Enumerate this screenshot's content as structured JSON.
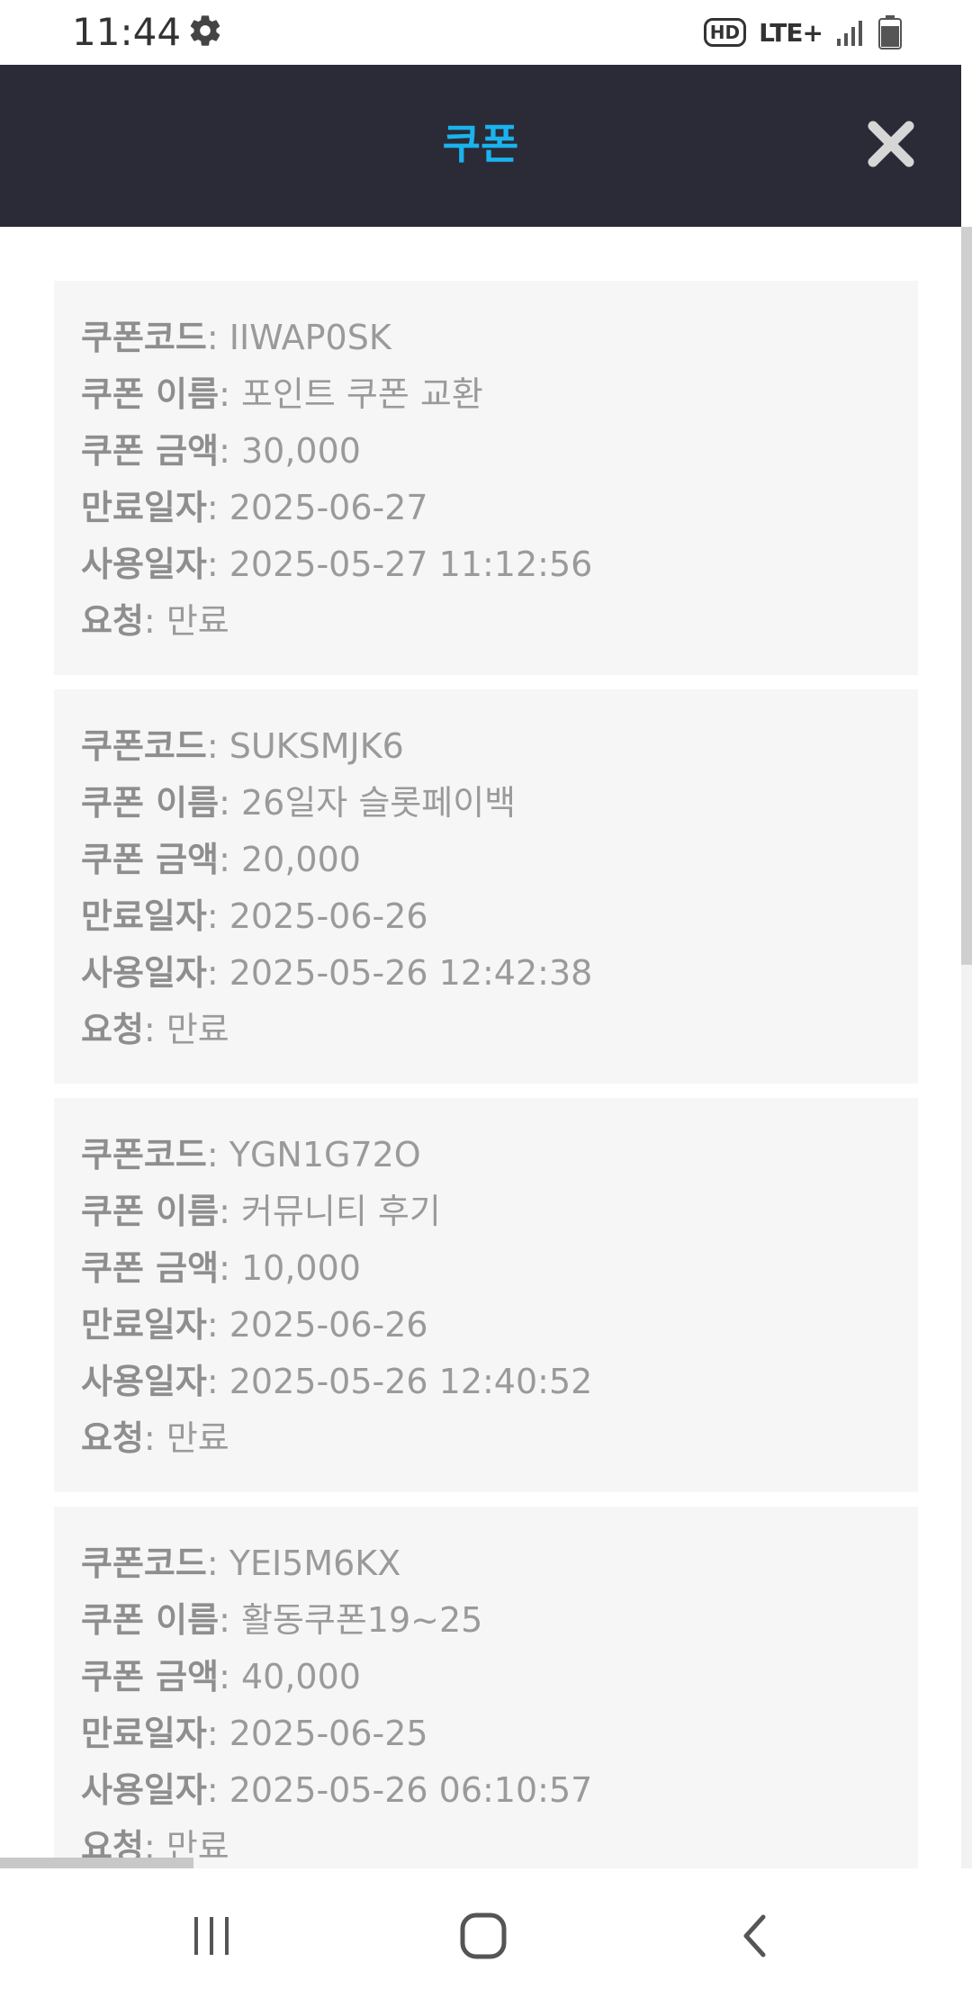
{
  "status_bar": {
    "time": "11:44",
    "hd_badge": "HD",
    "network": "LTE+"
  },
  "header": {
    "title": "쿠폰"
  },
  "labels": {
    "code": "쿠폰코드",
    "name": "쿠폰 이름",
    "amount": "쿠폰 금액",
    "expiry": "만료일자",
    "used": "사용일자",
    "request": "요청"
  },
  "coupons": [
    {
      "code": "IIWAP0SK",
      "name": "포인트 쿠폰 교환",
      "amount": "30,000",
      "expiry": "2025-06-27",
      "used": "2025-05-27 11:12:56",
      "request": "만료"
    },
    {
      "code": "SUKSMJK6",
      "name": "26일자 슬롯페이백",
      "amount": "20,000",
      "expiry": "2025-06-26",
      "used": "2025-05-26 12:42:38",
      "request": "만료"
    },
    {
      "code": "YGN1G72O",
      "name": "커뮤니티 후기",
      "amount": "10,000",
      "expiry": "2025-06-26",
      "used": "2025-05-26 12:40:52",
      "request": "만료"
    },
    {
      "code": "YEI5M6KX",
      "name": "활동쿠폰19~25",
      "amount": "40,000",
      "expiry": "2025-06-25",
      "used": "2025-05-26 06:10:57",
      "request": "만료"
    }
  ],
  "colors": {
    "header_bg": "#2a2b36",
    "title_accent": "#1ab3ee",
    "card_bg": "#f6f6f6",
    "text_gray": "#9a9a9a"
  }
}
